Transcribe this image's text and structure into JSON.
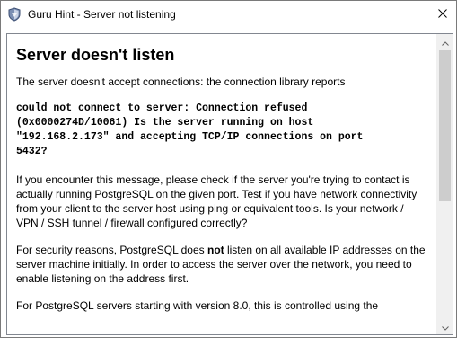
{
  "window": {
    "title": "Guru Hint - Server not listening"
  },
  "hint": {
    "heading": "Server doesn't listen",
    "intro": "The server doesn't accept connections: the connection library reports",
    "error": "could not connect to server: Connection refused\n(0x0000274D/10061) Is the server running on host\n\"192.168.2.173\" and accepting TCP/IP connections on port\n5432?",
    "para1": "If you encounter this message, please check if the server you're trying to contact is actually running PostgreSQL on the given port. Test if you have network connectivity from your client to the server host using ping or equivalent tools. Is your network / VPN / SSH tunnel / firewall configured correctly?",
    "para2_before": "For security reasons, PostgreSQL does ",
    "para2_bold": "not",
    "para2_after": " listen on all available IP addresses on the server machine initially. In order to access the server over the network, you need to enable listening on the address first.",
    "para3": "For PostgreSQL servers starting with version 8.0, this is controlled using the"
  },
  "icons": {
    "app": "shield-icon",
    "close": "close-icon",
    "scroll_up": "chevron-up-icon",
    "scroll_down": "chevron-down-icon"
  }
}
